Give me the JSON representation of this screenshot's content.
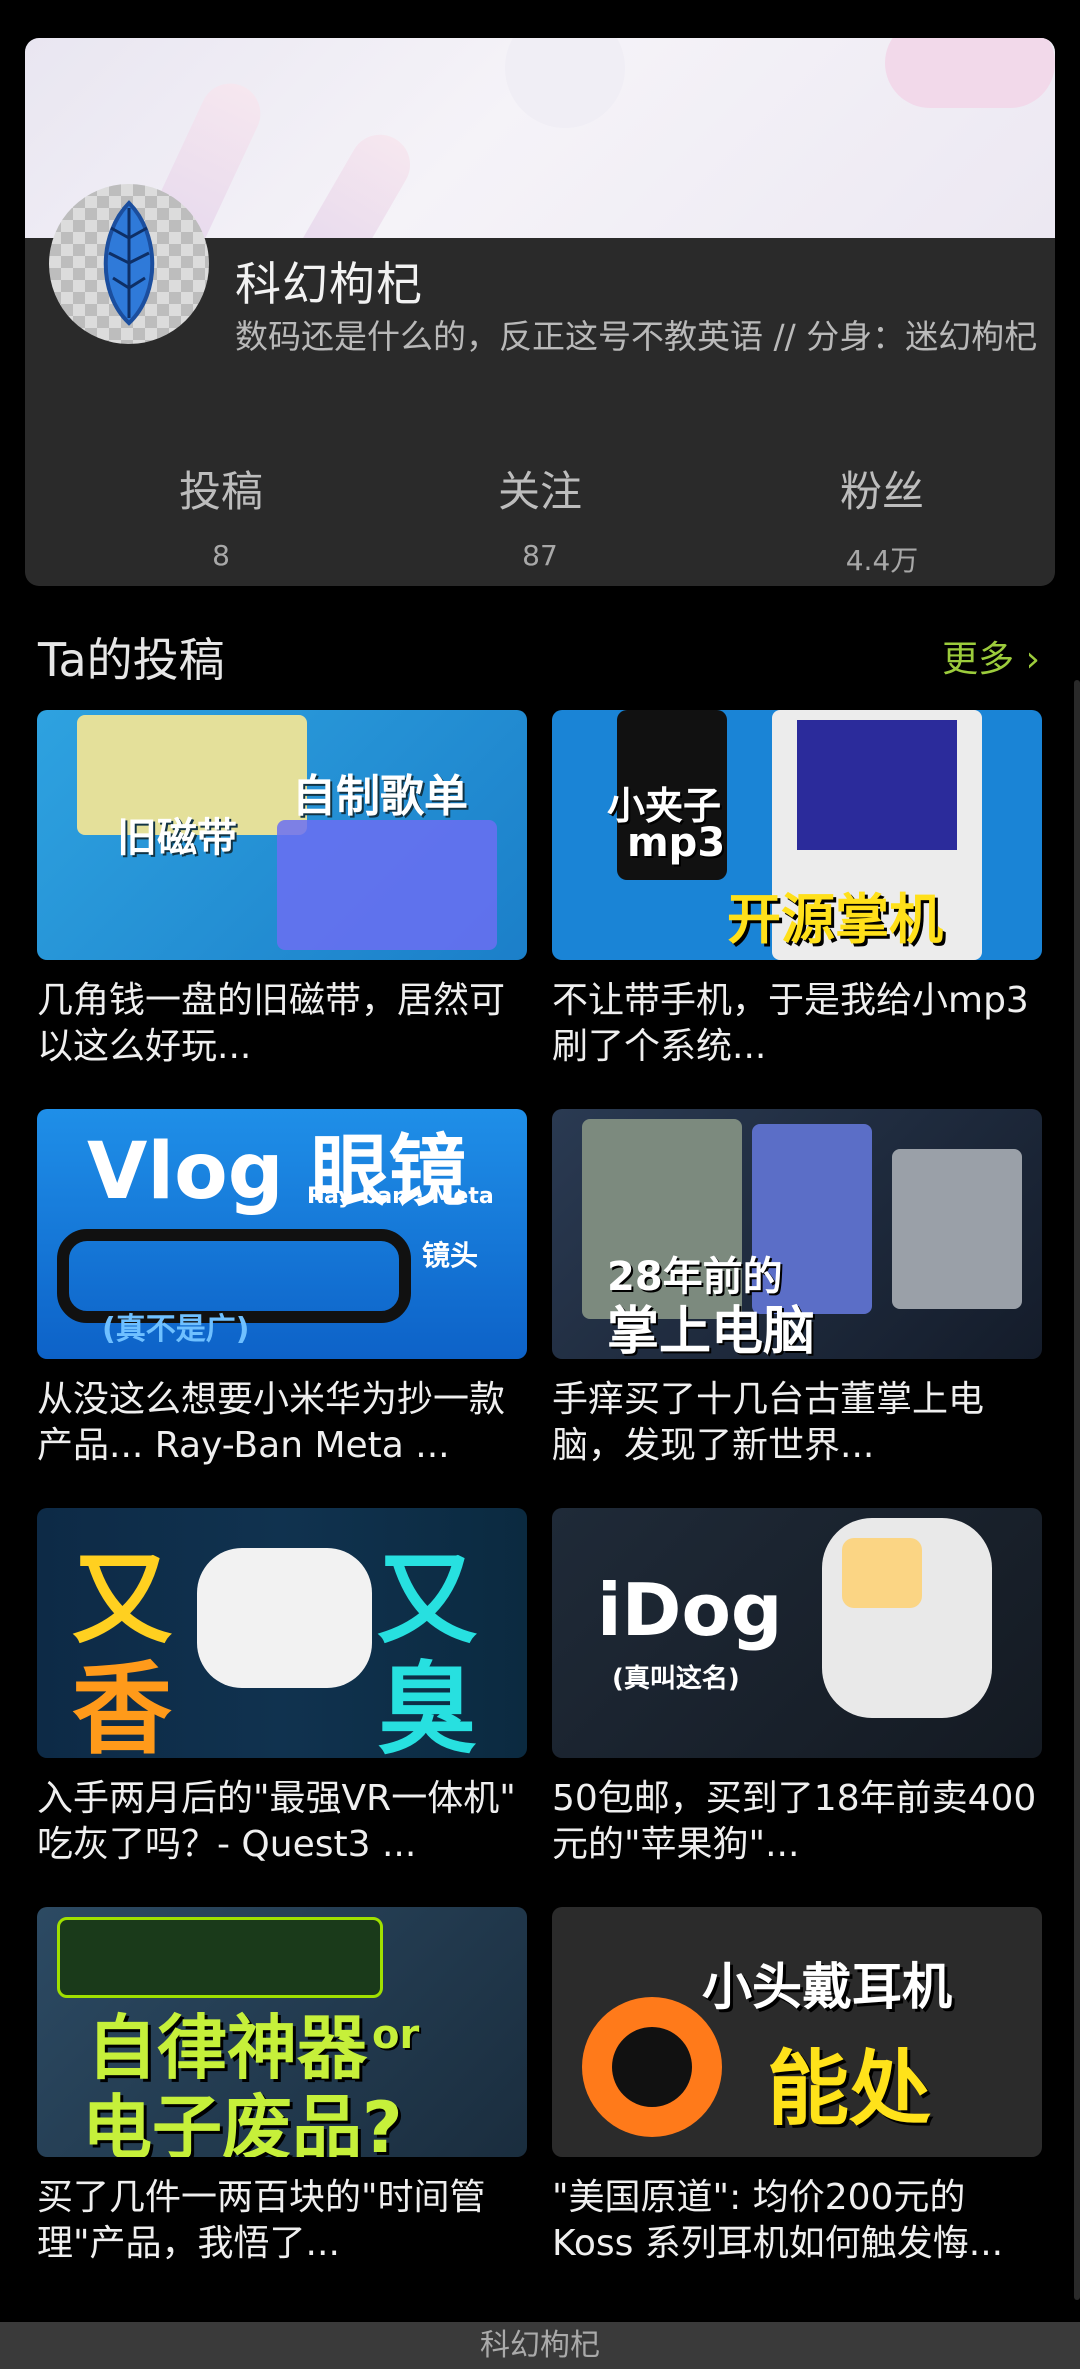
{
  "profile": {
    "name": "科幻枸杞",
    "bio": "数码还是什么的，反正这号不教英语 // 分身：迷幻枸杞",
    "stats": [
      {
        "label": "投稿",
        "value": "8"
      },
      {
        "label": "关注",
        "value": "87"
      },
      {
        "label": "粉丝",
        "value": "4.4万"
      }
    ]
  },
  "section": {
    "title": "Ta的投稿",
    "more": "更多 ›"
  },
  "videos": [
    {
      "title": "几角钱一盘的旧磁带，居然可以这么好玩...",
      "thumb_text": [
        "旧磁带",
        "自制歌单"
      ]
    },
    {
      "title": "不让带手机，于是我给小mp3刷了个系统...",
      "thumb_text": [
        "小夹子",
        "mp3",
        "开源掌机"
      ]
    },
    {
      "title": "从没这么想要小米华为抄一款产品... Ray-Ban Meta ...",
      "thumb_text": [
        "Vlog 眼镜",
        "Ray-ban · Meta",
        "镜头",
        "(真不是广)"
      ]
    },
    {
      "title": "手痒买了十几台古董掌上电脑，发现了新世界...",
      "thumb_text": [
        "28年前的",
        "掌上电脑"
      ]
    },
    {
      "title": "入手两月后的\"最强VR一体机\" 吃灰了吗？- Quest3 ...",
      "thumb_text": [
        "又",
        "香",
        "又",
        "臭"
      ]
    },
    {
      "title": "50包邮，买到了18年前卖400元的\"苹果狗\"...",
      "thumb_text": [
        "iDog",
        "(真叫这名)"
      ]
    },
    {
      "title": "买了几件一两百块的\"时间管理\"产品，我悟了...",
      "thumb_text": [
        "自律神器",
        "or",
        "电子废品?"
      ]
    },
    {
      "title": "\"美国原道\": 均价200元的 Koss 系列耳机如何触发悔...",
      "thumb_text": [
        "小头戴耳机",
        "能处"
      ]
    }
  ],
  "bottom_bar": {
    "title": "科幻枸杞"
  },
  "colors": {
    "accent": "#9ccc3c",
    "card_bg": "#2a2a2a",
    "background": "#000000"
  }
}
